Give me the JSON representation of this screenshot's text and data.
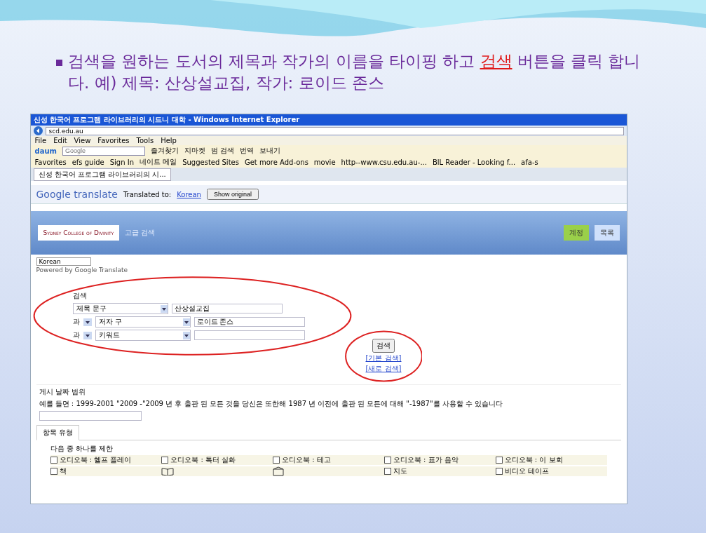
{
  "slide": {
    "instruction": {
      "before": "검색을 원하는 도서의 제목과 작가의 이름을  타이핑 하고 ",
      "highlight": "검색",
      "after": " 버튼을 클릭 합니다. 예) 제목: 산상설교집, 작가: 로이드 존스"
    }
  },
  "window": {
    "title": "신성 한국어 프로그램 라이브러리의 시드니 대학 - Windows Internet Explorer",
    "address": "scd.edu.au"
  },
  "menu": [
    "File",
    "Edit",
    "View",
    "Favorites",
    "Tools",
    "Help"
  ],
  "toolbar": {
    "brand": "daum",
    "search_placeholder": "Google",
    "items": [
      "즐겨찾기",
      "지마켓",
      "범 검색",
      "번역",
      "보내기"
    ]
  },
  "favorites": [
    "Favorites",
    "efs guide",
    "Sign In",
    "네이트 메일",
    "Suggested Sites",
    "Get more Add-ons",
    "movie",
    "http--www.csu.edu.au-...",
    "BlL Reader - Looking f...",
    "afa-s"
  ],
  "tab": {
    "label": "신성 한국어 프로그램 라이브러리의 시...",
    "selected": true
  },
  "translate_bar": {
    "logo": "Google translate",
    "label": "Translated to:",
    "language": "Korean",
    "button": "Show original"
  },
  "header": {
    "logo": "Sydney College of Divinity",
    "subtitle": "고급 검색",
    "buttons": [
      {
        "label": "계정",
        "kind": "primary"
      },
      {
        "label": "목록",
        "kind": "secondary"
      }
    ]
  },
  "language_select": {
    "value": "Korean",
    "powered": "Powered by Google Translate"
  },
  "search": {
    "heading": "검색",
    "rows": [
      {
        "connector": "",
        "field": "제목 문구",
        "value": "산상설교집"
      },
      {
        "connector": "과",
        "field": "저자 구",
        "value": "로이드 존스"
      },
      {
        "connector": "과",
        "field": "키워드",
        "value": ""
      }
    ],
    "button": "검색",
    "links": [
      "[기본 검색]",
      "[새로 검색]"
    ]
  },
  "date_range": {
    "heading": "게시 날짜 범위",
    "hint": "예를 들면 : 1999-2001 \"2009 -\"2009 년 후 출판 된 모든 것을 당신은 또한해 1987 년 이전에 출판 된 모든에 대해 \"-1987\"를 사용할 수 있습니다"
  },
  "item_tabs": [
    {
      "label": "항목 유형",
      "selected": true
    }
  ],
  "limit": {
    "heading": "다음 중 하나를 제한",
    "options": [
      {
        "label": "오디오북 : 헬프 플레이",
        "checked": false
      },
      {
        "label": "오디오북 : 톡터 실화",
        "checked": false
      },
      {
        "label": "오디오북 : 테고",
        "checked": false
      },
      {
        "label": "오디오북 : 표가 음악",
        "checked": false
      },
      {
        "label": "오디오북 : 이 보회",
        "checked": false
      }
    ],
    "more": [
      {
        "kind": "checkbox",
        "label": "책",
        "checked": false
      },
      {
        "kind": "book"
      },
      {
        "kind": "box"
      },
      {
        "kind": "checkbox",
        "label": "지도",
        "checked": false
      },
      {
        "kind": "checkbox",
        "label": "비디오 테이프",
        "checked": false
      }
    ]
  }
}
